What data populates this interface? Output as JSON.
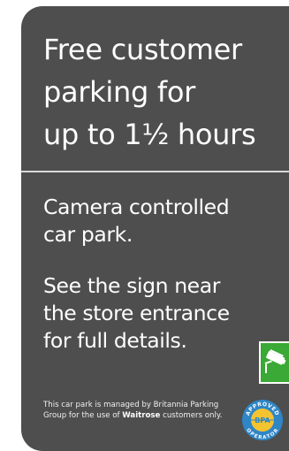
{
  "sign": {
    "background_color": "#4e4e4e",
    "headline_lines": [
      "Free customer",
      "parking for",
      "up to 1½ hours"
    ],
    "paragraph1_lines": [
      "Camera controlled",
      "car park."
    ],
    "paragraph2_lines": [
      "See the sign near",
      "the store entrance",
      "for full details."
    ],
    "footer": {
      "text_before": "This car park is managed by Britannia Parking Group for the use of ",
      "brand": "Waitrose",
      "text_after": " customers only."
    },
    "camera_icon": "cctv-camera-icon",
    "camera_badge_color": "#3aa935",
    "logo": {
      "icon": "bpa-approved-operator-logo",
      "ring_top_text": "APPROVED",
      "center_text": "BPA",
      "ring_bottom_text": "OPERATOR",
      "ring_color": "#2f86c6",
      "center_color": "#f4c430"
    }
  }
}
